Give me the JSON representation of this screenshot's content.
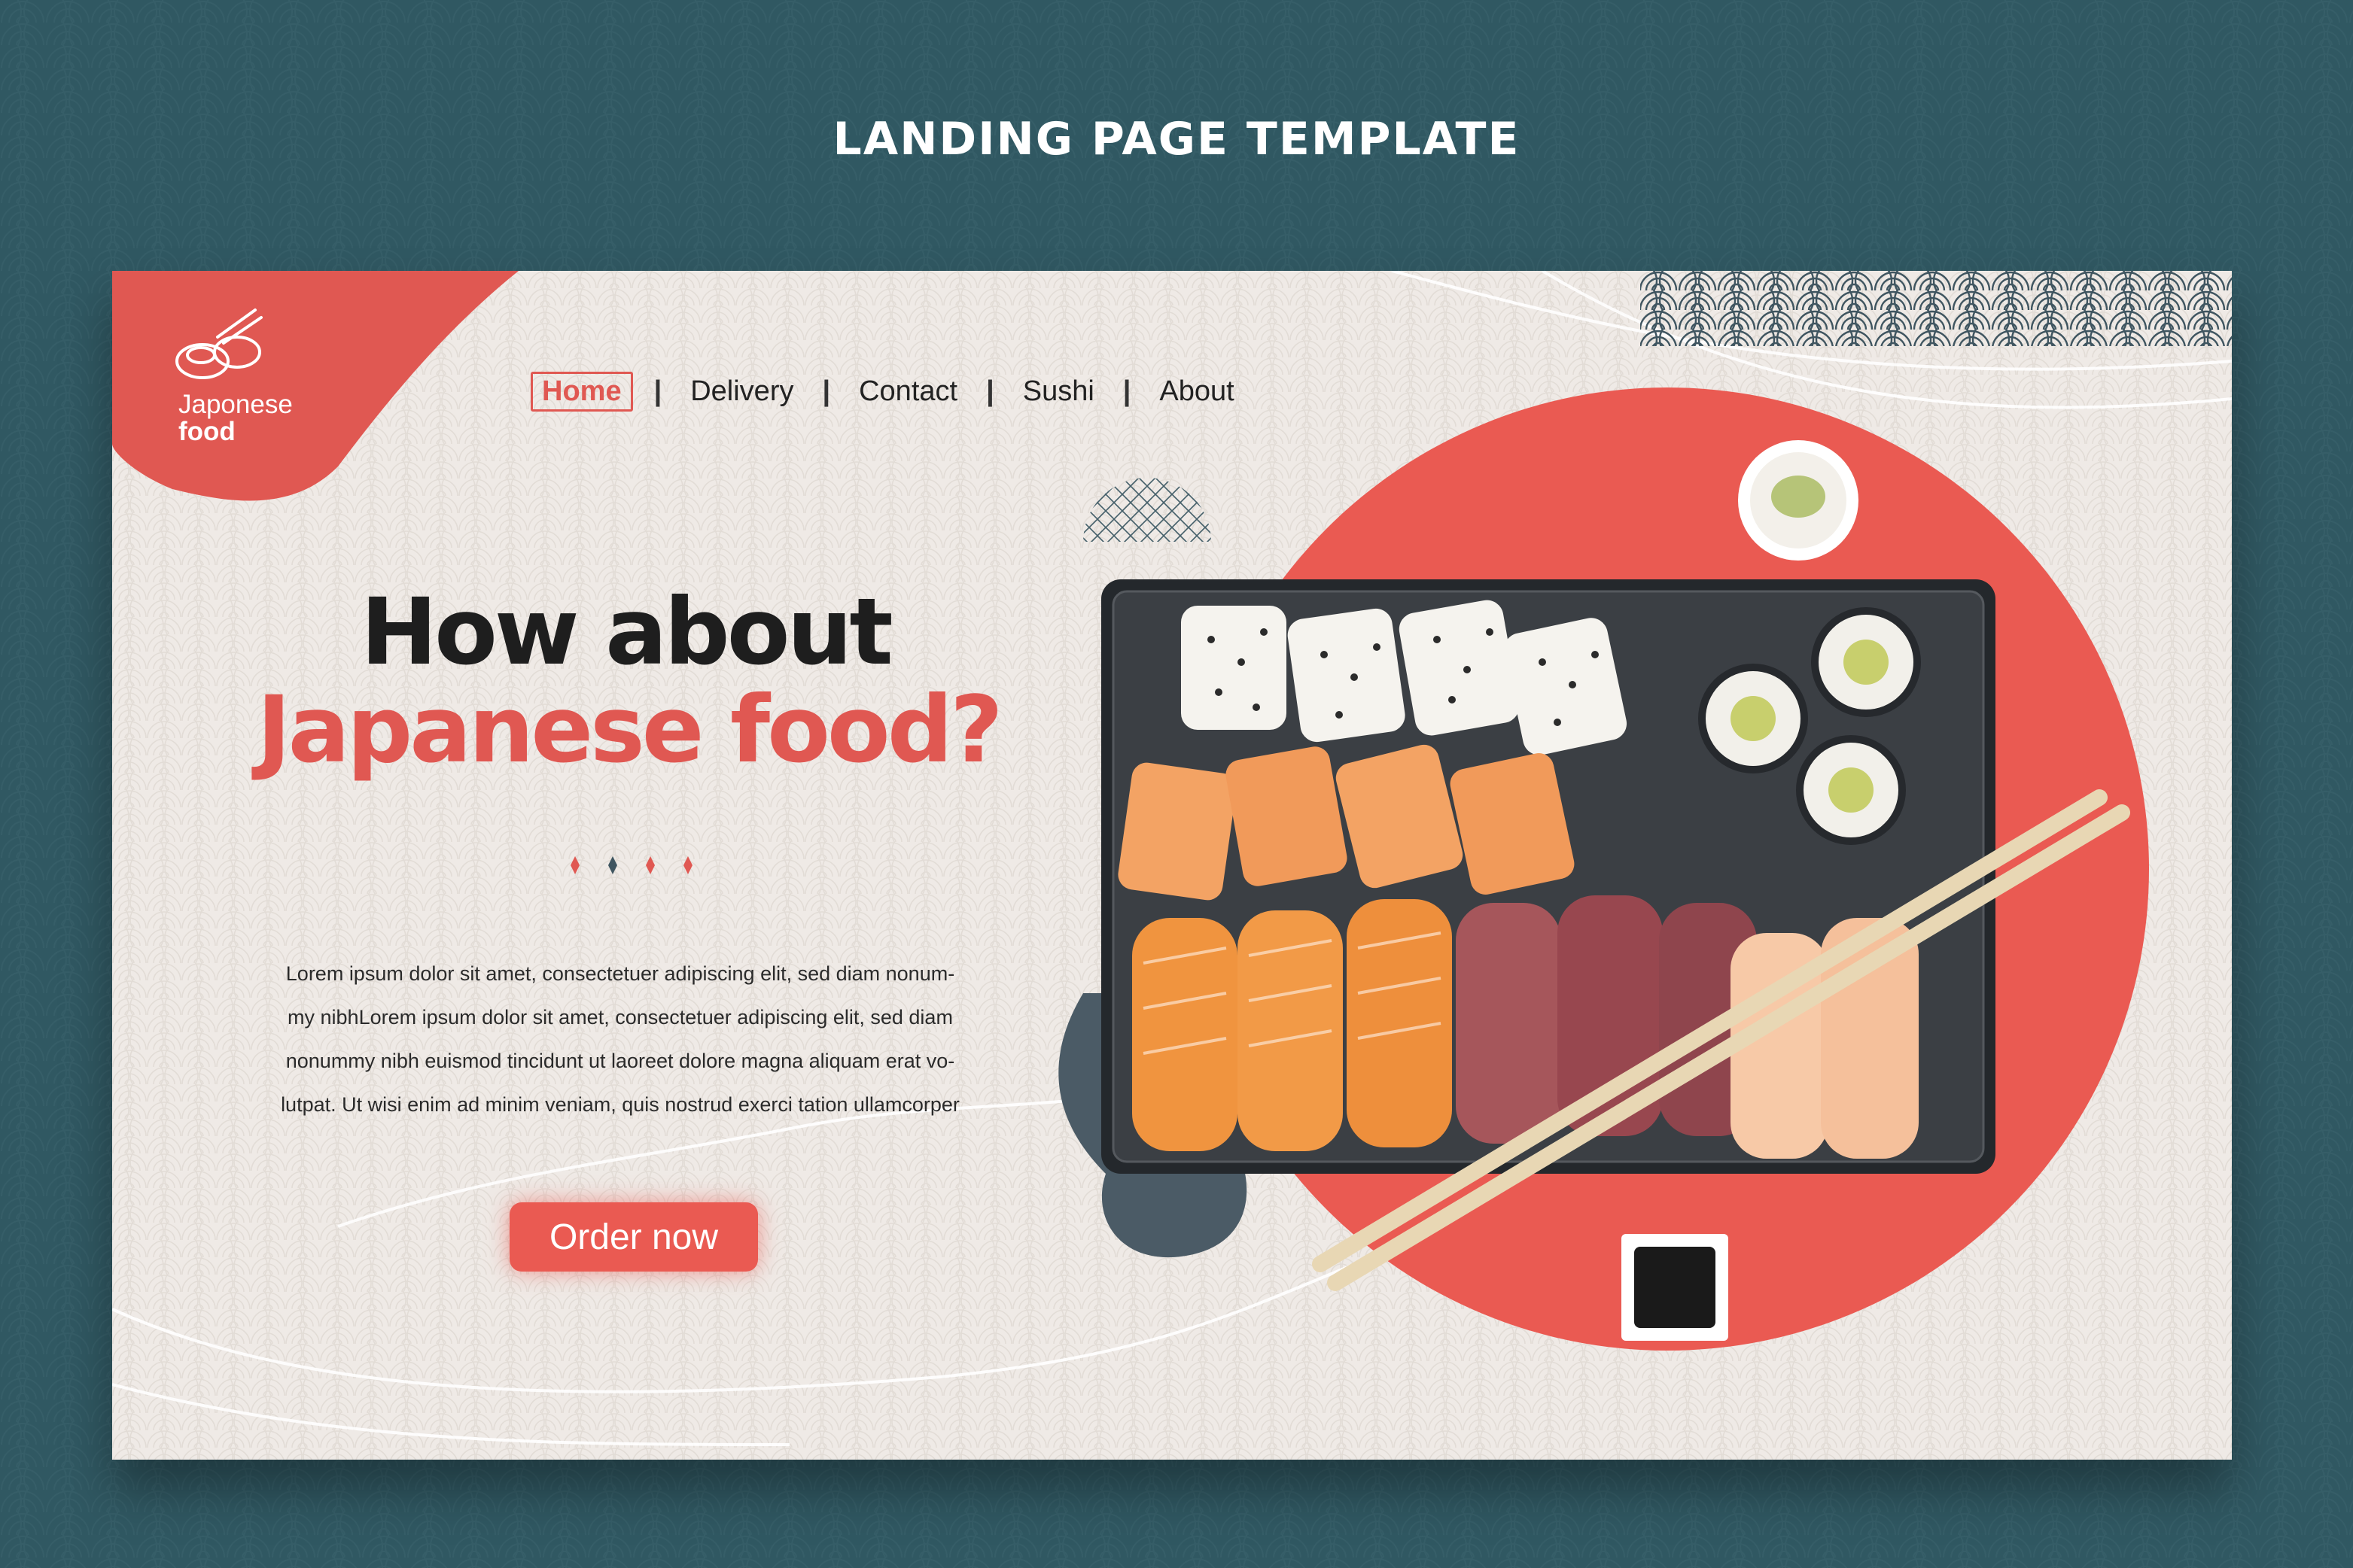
{
  "page": {
    "heading": "LANDING PAGE TEMPLATE"
  },
  "logo": {
    "line1": "Japonese",
    "line2": "food",
    "icon": "sushi-chopsticks-icon"
  },
  "nav": {
    "items": [
      {
        "label": "Home",
        "active": true
      },
      {
        "label": "Delivery",
        "active": false
      },
      {
        "label": "Contact",
        "active": false
      },
      {
        "label": "Sushi",
        "active": false
      },
      {
        "label": "About",
        "active": false
      }
    ],
    "separator": "|"
  },
  "hero": {
    "headline_line1": "How about",
    "headline_line2": "Japanese food?",
    "body": "Lorem ipsum dolor sit amet, consectetuer adipiscing elit, sed diam nonum-my nibhLorem ipsum dolor sit amet, consectetuer adipiscing elit, sed diam nonummy nibh euismod tincidunt ut laoreet dolore magna aliquam erat vo-lutpat. Ut wisi enim ad minim veniam, quis nostrud exerci tation ullamcorper",
    "body_lines": [
      "Lorem ipsum dolor sit amet, consectetuer adipiscing elit, sed diam nonum-",
      "my nibhLorem ipsum dolor sit amet, consectetuer adipiscing elit, sed diam",
      "nonummy nibh euismod tincidunt ut laoreet dolore magna aliquam erat vo-",
      "lutpat. Ut wisi enim ad minim veniam, quis nostrud exerci tation ullamcorper"
    ],
    "cta_label": "Order now"
  },
  "colors": {
    "background": "#305862",
    "card": "#efeae6",
    "accent": "#e05852",
    "dark": "#1e1e1e",
    "slate": "#4b5b66"
  },
  "image": {
    "subject": "sushi-platter-with-chopsticks"
  }
}
